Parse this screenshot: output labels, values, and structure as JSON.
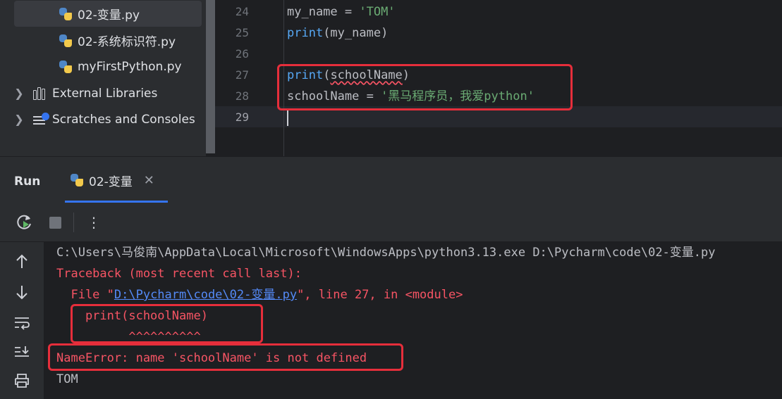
{
  "project_tree": {
    "files": [
      "02-变量.py",
      "02-系统标识符.py",
      "myFirstPython.py"
    ],
    "selected_file": "02-变量.py",
    "external_libraries": "External Libraries",
    "scratches": "Scratches and Consoles"
  },
  "editor": {
    "lines": [
      {
        "num": "24",
        "parts": [
          {
            "t": "my_name = ",
            "c": "norm"
          },
          {
            "t": "'TOM'",
            "c": "str"
          }
        ]
      },
      {
        "num": "25",
        "parts": [
          {
            "t": "print",
            "c": "kw"
          },
          {
            "t": "(my_name)",
            "c": "norm"
          }
        ]
      },
      {
        "num": "26",
        "parts": []
      },
      {
        "num": "27",
        "parts": [
          {
            "t": "print",
            "c": "kw"
          },
          {
            "t": "(",
            "c": "norm"
          },
          {
            "t": "schoolName",
            "c": "err"
          },
          {
            "t": ")",
            "c": "norm"
          }
        ]
      },
      {
        "num": "28",
        "parts": [
          {
            "t": "schoolName = ",
            "c": "norm"
          },
          {
            "t": "'黑马程序员，我爱python'",
            "c": "str"
          }
        ]
      },
      {
        "num": "29",
        "parts": []
      }
    ],
    "current_line": "29"
  },
  "run": {
    "title": "Run",
    "tab_label": "02-变量",
    "toolbar": {
      "rerun": "rerun-icon",
      "stop": "stop-icon",
      "more": "⋮"
    },
    "console": {
      "command": "C:\\Users\\马俊南\\AppData\\Local\\Microsoft\\WindowsApps\\python3.13.exe D:\\Pycharm\\code\\02-变量.py",
      "traceback_header": "Traceback (most recent call last):",
      "file_prefix": "  File \"",
      "file_link": "D:\\Pycharm\\code\\02-变量.py",
      "file_suffix": "\", line 27, in <module>",
      "code_line": "    print(schoolName)",
      "carets": "          ^^^^^^^^^^",
      "error": "NameError: name 'schoolName' is not defined",
      "output": "TOM"
    }
  },
  "colors": {
    "keyword": "#56a8f5",
    "string": "#6aab73",
    "error": "#f75464",
    "link": "#548af7",
    "annotation_box": "#e62e3b"
  }
}
